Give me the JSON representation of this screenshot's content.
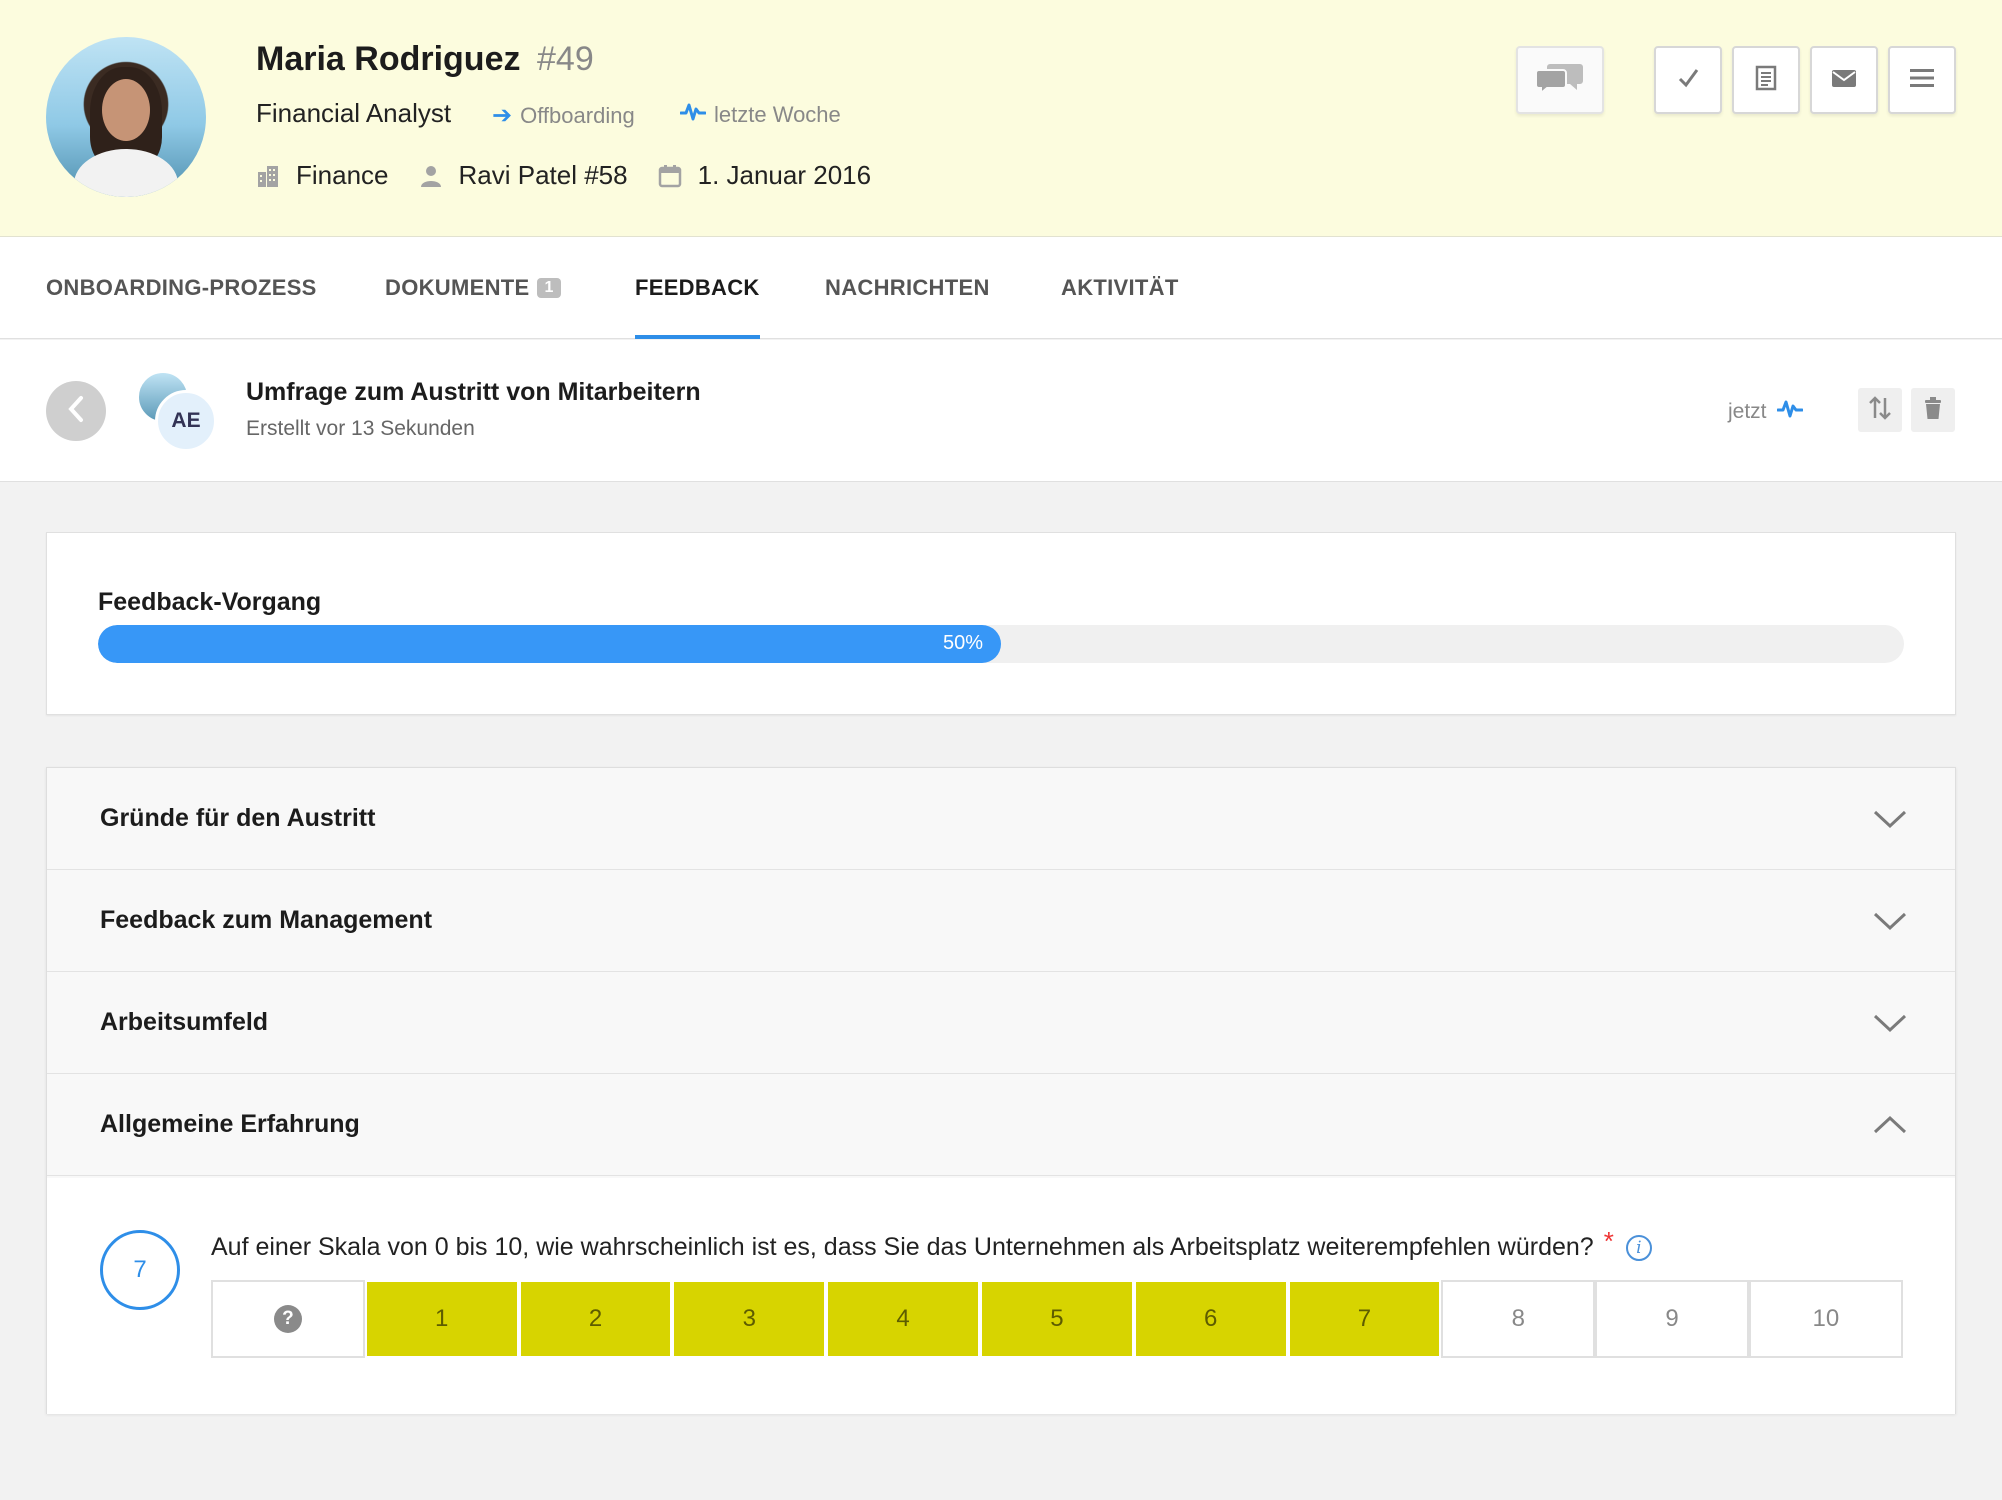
{
  "header": {
    "name": "Maria Rodriguez",
    "employee_id": "#49",
    "job_title": "Financial Analyst",
    "status": "Offboarding",
    "activity": "letzte Woche",
    "department": "Finance",
    "manager": "Ravi Patel #58",
    "start_date": "1. Januar 2016",
    "icons": [
      "building-icon",
      "person-icon",
      "calendar-icon",
      "comments-icon",
      "checkmark-icon",
      "document-icon",
      "envelope-icon",
      "menu-icon"
    ]
  },
  "tabs": [
    {
      "label": "ONBOARDING-PROZESS"
    },
    {
      "label": "DOKUMENTE",
      "badge": "1"
    },
    {
      "label": "FEEDBACK",
      "active": true
    },
    {
      "label": "NACHRICHTEN"
    },
    {
      "label": "AKTIVITÄT"
    }
  ],
  "survey": {
    "assignee_initials": "AE",
    "title": "Umfrage zum Austritt von Mitarbeitern",
    "created": "Erstellt vor 13 Sekunden",
    "time": "jetzt"
  },
  "progress": {
    "label": "Feedback-Vorgang",
    "percent_text": "50%",
    "value": 0.5
  },
  "sections": [
    {
      "title": "Gründe für den Austritt",
      "expanded": false
    },
    {
      "title": "Feedback zum Management",
      "expanded": false
    },
    {
      "title": "Arbeitsumfeld",
      "expanded": false
    },
    {
      "title": "Allgemeine Erfahrung",
      "expanded": true
    }
  ],
  "question": {
    "number": "7",
    "text": "Auf einer Skala von 0 bis 10, wie wahrscheinlich ist es, dass Sie das Unternehmen als Arbeitsplatz weiterempfehlen würden?",
    "required_mark": "*",
    "info_mark": "i",
    "scale_unknown": "?",
    "scale": [
      "1",
      "2",
      "3",
      "4",
      "5",
      "6",
      "7",
      "8",
      "9",
      "10"
    ],
    "selected_value": 7
  },
  "colors": {
    "header_bg": "#fcfcde",
    "accent": "#2e8ee8",
    "progress_fill": "#3797f7",
    "scale_selected": "#d7d400"
  }
}
